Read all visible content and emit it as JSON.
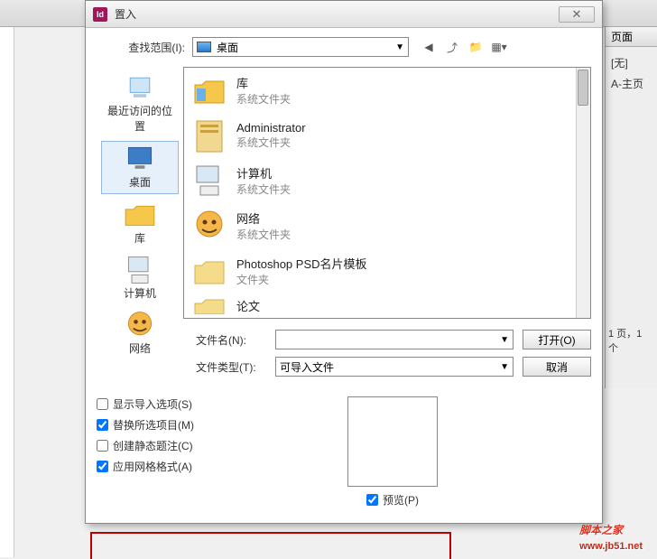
{
  "dialog": {
    "title": "置入",
    "lookup_label": "查找范围(I):",
    "lookup_value": "桌面",
    "filename_label": "文件名(N):",
    "filename_value": "",
    "filetype_label": "文件类型(T):",
    "filetype_value": "可导入文件",
    "open_btn": "打开(O)",
    "cancel_btn": "取消"
  },
  "sidebar": [
    {
      "label": "最近访问的位置"
    },
    {
      "label": "桌面"
    },
    {
      "label": "库"
    },
    {
      "label": "计算机"
    },
    {
      "label": "网络"
    }
  ],
  "files": [
    {
      "name": "库",
      "type": "系统文件夹"
    },
    {
      "name": "Administrator",
      "type": "系统文件夹"
    },
    {
      "name": "计算机",
      "type": "系统文件夹"
    },
    {
      "name": "网络",
      "type": "系统文件夹"
    },
    {
      "name": "Photoshop PSD名片模板",
      "type": "文件夹"
    },
    {
      "name": "论文",
      "type": ""
    }
  ],
  "checks": {
    "show_import": "显示导入选项(S)",
    "replace_sel": "替换所选项目(M)",
    "create_static": "创建静态题注(C)",
    "apply_grid": "应用网格格式(A)",
    "preview": "预览(P)"
  },
  "panel": {
    "tab": "页面",
    "none": "[无]",
    "master": "A-主页",
    "status": "1 页，1 个"
  },
  "watermark": {
    "text": "脚本之家",
    "url": "www.jb51.net"
  }
}
